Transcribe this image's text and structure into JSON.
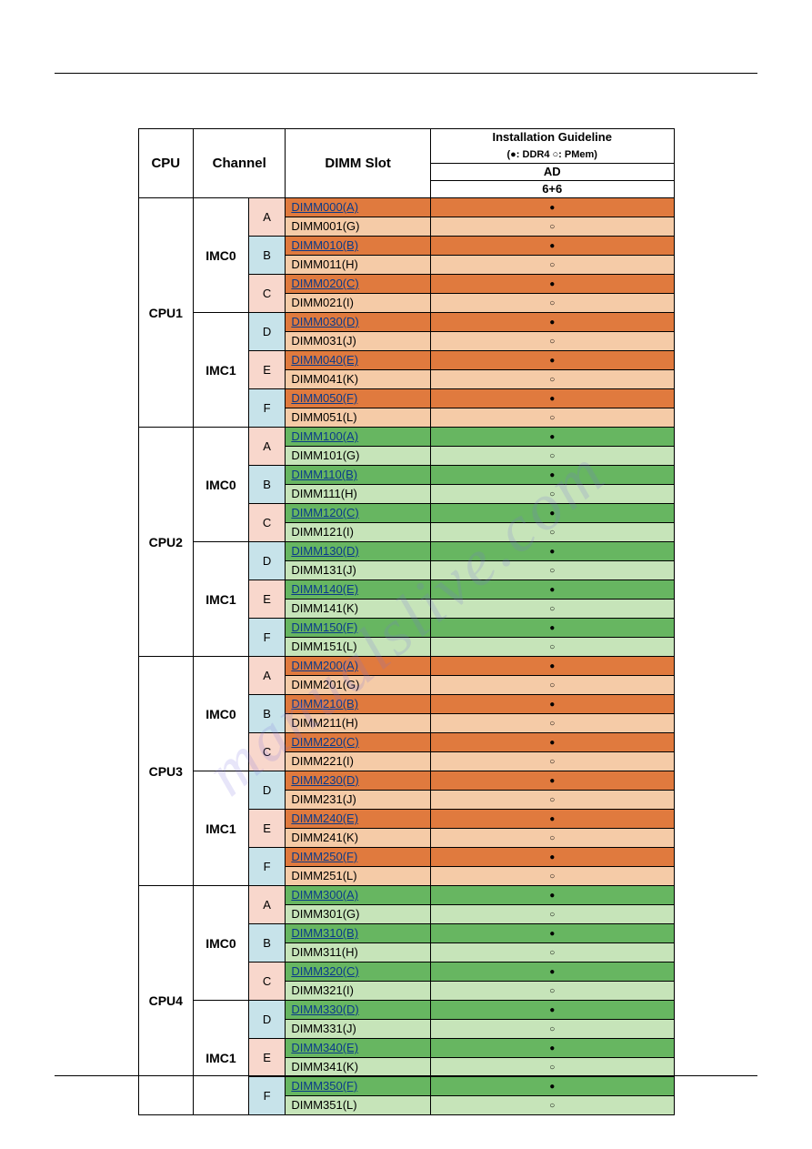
{
  "watermark": "manualslive.com",
  "headers": {
    "cpu": "CPU",
    "channel": "Channel",
    "dimm_slot": "DIMM Slot",
    "guideline_top": "Installation Guideline",
    "guideline_legend": "(●: DDR4  ○: PMem)",
    "ad": "AD",
    "ratio": "6+6"
  },
  "cpus": [
    {
      "name": "CPU1",
      "theme": "orange",
      "imcs": [
        {
          "name": "IMC0",
          "channels": [
            {
              "label": "A",
              "ch_color": "pink",
              "slots": [
                {
                  "name": "DIMM000(A)",
                  "mark": "filled"
                },
                {
                  "name": "DIMM001(G)",
                  "mark": "open"
                }
              ]
            },
            {
              "label": "B",
              "ch_color": "blue",
              "slots": [
                {
                  "name": "DIMM010(B)",
                  "mark": "filled"
                },
                {
                  "name": "DIMM011(H)",
                  "mark": "open"
                }
              ]
            },
            {
              "label": "C",
              "ch_color": "pink",
              "slots": [
                {
                  "name": "DIMM020(C)",
                  "mark": "filled"
                },
                {
                  "name": "DIMM021(I)",
                  "mark": "open"
                }
              ]
            }
          ]
        },
        {
          "name": "IMC1",
          "channels": [
            {
              "label": "D",
              "ch_color": "blue",
              "slots": [
                {
                  "name": "DIMM030(D)",
                  "mark": "filled"
                },
                {
                  "name": "DIMM031(J)",
                  "mark": "open"
                }
              ]
            },
            {
              "label": "E",
              "ch_color": "pink",
              "slots": [
                {
                  "name": "DIMM040(E)",
                  "mark": "filled"
                },
                {
                  "name": "DIMM041(K)",
                  "mark": "open"
                }
              ]
            },
            {
              "label": "F",
              "ch_color": "blue",
              "slots": [
                {
                  "name": "DIMM050(F)",
                  "mark": "filled"
                },
                {
                  "name": "DIMM051(L)",
                  "mark": "open"
                }
              ]
            }
          ]
        }
      ]
    },
    {
      "name": "CPU2",
      "theme": "green",
      "imcs": [
        {
          "name": "IMC0",
          "channels": [
            {
              "label": "A",
              "ch_color": "pink",
              "slots": [
                {
                  "name": "DIMM100(A)",
                  "mark": "filled"
                },
                {
                  "name": "DIMM101(G)",
                  "mark": "open"
                }
              ]
            },
            {
              "label": "B",
              "ch_color": "blue",
              "slots": [
                {
                  "name": "DIMM110(B)",
                  "mark": "filled"
                },
                {
                  "name": "DIMM111(H)",
                  "mark": "open"
                }
              ]
            },
            {
              "label": "C",
              "ch_color": "pink",
              "slots": [
                {
                  "name": "DIMM120(C)",
                  "mark": "filled"
                },
                {
                  "name": "DIMM121(I)",
                  "mark": "open"
                }
              ]
            }
          ]
        },
        {
          "name": "IMC1",
          "channels": [
            {
              "label": "D",
              "ch_color": "blue",
              "slots": [
                {
                  "name": "DIMM130(D)",
                  "mark": "filled"
                },
                {
                  "name": "DIMM131(J)",
                  "mark": "open"
                }
              ]
            },
            {
              "label": "E",
              "ch_color": "pink",
              "slots": [
                {
                  "name": "DIMM140(E)",
                  "mark": "filled"
                },
                {
                  "name": "DIMM141(K)",
                  "mark": "open"
                }
              ]
            },
            {
              "label": "F",
              "ch_color": "blue",
              "slots": [
                {
                  "name": "DIMM150(F)",
                  "mark": "filled"
                },
                {
                  "name": "DIMM151(L)",
                  "mark": "open"
                }
              ]
            }
          ]
        }
      ]
    },
    {
      "name": "CPU3",
      "theme": "orange",
      "imcs": [
        {
          "name": "IMC0",
          "channels": [
            {
              "label": "A",
              "ch_color": "pink",
              "slots": [
                {
                  "name": "DIMM200(A)",
                  "mark": "filled"
                },
                {
                  "name": "DIMM201(G)",
                  "mark": "open"
                }
              ]
            },
            {
              "label": "B",
              "ch_color": "blue",
              "slots": [
                {
                  "name": "DIMM210(B)",
                  "mark": "filled"
                },
                {
                  "name": "DIMM211(H)",
                  "mark": "open"
                }
              ]
            },
            {
              "label": "C",
              "ch_color": "pink",
              "slots": [
                {
                  "name": "DIMM220(C)",
                  "mark": "filled"
                },
                {
                  "name": "DIMM221(I)",
                  "mark": "open"
                }
              ]
            }
          ]
        },
        {
          "name": "IMC1",
          "channels": [
            {
              "label": "D",
              "ch_color": "blue",
              "slots": [
                {
                  "name": "DIMM230(D)",
                  "mark": "filled"
                },
                {
                  "name": "DIMM231(J)",
                  "mark": "open"
                }
              ]
            },
            {
              "label": "E",
              "ch_color": "pink",
              "slots": [
                {
                  "name": "DIMM240(E)",
                  "mark": "filled"
                },
                {
                  "name": "DIMM241(K)",
                  "mark": "open"
                }
              ]
            },
            {
              "label": "F",
              "ch_color": "blue",
              "slots": [
                {
                  "name": "DIMM250(F)",
                  "mark": "filled"
                },
                {
                  "name": "DIMM251(L)",
                  "mark": "open"
                }
              ]
            }
          ]
        }
      ]
    },
    {
      "name": "CPU4",
      "theme": "green",
      "imcs": [
        {
          "name": "IMC0",
          "channels": [
            {
              "label": "A",
              "ch_color": "pink",
              "slots": [
                {
                  "name": "DIMM300(A)",
                  "mark": "filled"
                },
                {
                  "name": "DIMM301(G)",
                  "mark": "open"
                }
              ]
            },
            {
              "label": "B",
              "ch_color": "blue",
              "slots": [
                {
                  "name": "DIMM310(B)",
                  "mark": "filled"
                },
                {
                  "name": "DIMM311(H)",
                  "mark": "open"
                }
              ]
            },
            {
              "label": "C",
              "ch_color": "pink",
              "slots": [
                {
                  "name": "DIMM320(C)",
                  "mark": "filled"
                },
                {
                  "name": "DIMM321(I)",
                  "mark": "open"
                }
              ]
            }
          ]
        },
        {
          "name": "IMC1",
          "channels": [
            {
              "label": "D",
              "ch_color": "blue",
              "slots": [
                {
                  "name": "DIMM330(D)",
                  "mark": "filled"
                },
                {
                  "name": "DIMM331(J)",
                  "mark": "open"
                }
              ]
            },
            {
              "label": "E",
              "ch_color": "pink",
              "slots": [
                {
                  "name": "DIMM340(E)",
                  "mark": "filled"
                },
                {
                  "name": "DIMM341(K)",
                  "mark": "open"
                }
              ]
            },
            {
              "label": "F",
              "ch_color": "blue",
              "slots": [
                {
                  "name": "DIMM350(F)",
                  "mark": "filled"
                },
                {
                  "name": "DIMM351(L)",
                  "mark": "open"
                }
              ]
            }
          ]
        }
      ]
    }
  ]
}
